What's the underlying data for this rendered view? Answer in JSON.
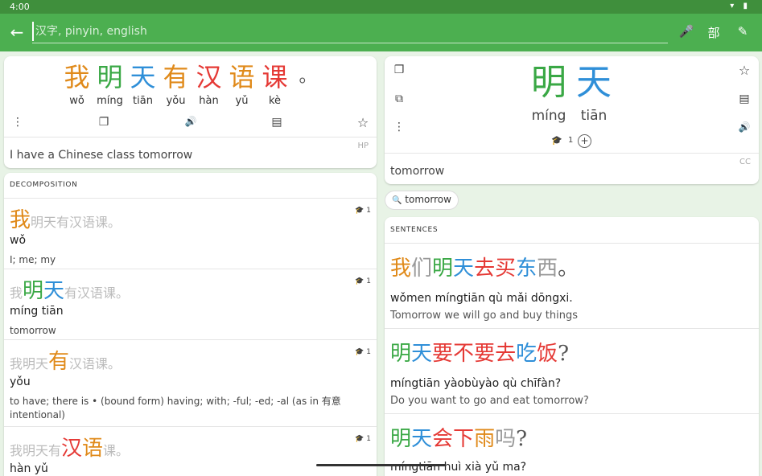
{
  "status": {
    "time": "4:00",
    "icons": "▾ ▮"
  },
  "search": {
    "placeholder": "汉字, pinyin, english",
    "back": "←",
    "mic": "🎤",
    "radical": "部",
    "brush": "✎"
  },
  "main_card": {
    "chars": [
      {
        "hz": "我",
        "py": "wǒ"
      },
      {
        "hz": "明",
        "py": "míng"
      },
      {
        "hz": "天",
        "py": "tiān"
      },
      {
        "hz": "有",
        "py": "yǒu"
      },
      {
        "hz": "汉",
        "py": "hàn"
      },
      {
        "hz": "语",
        "py": "yǔ"
      },
      {
        "hz": "课",
        "py": "kè"
      },
      {
        "hz": "。",
        "py": ""
      }
    ],
    "translation": "I have a Chinese class tomorrow",
    "source": "HP",
    "icons": {
      "more": "⋮",
      "copy": "❐",
      "audio": "🔊",
      "comment": "▤",
      "star": "☆"
    }
  },
  "word_card": {
    "chars": [
      {
        "hz": "明",
        "py": "míng"
      },
      {
        "hz": "天",
        "py": "tiān"
      }
    ],
    "level": "1",
    "add": "+",
    "translation": "tomorrow",
    "source": "CC",
    "chip": "tomorrow",
    "icons": {
      "copy": "❐",
      "open": "⧉",
      "more": "⋮",
      "star": "☆",
      "comment": "▤",
      "audio": "🔊",
      "cap": "🎓",
      "search": "🔍"
    }
  },
  "decomposition": {
    "title": "DECOMPOSITION",
    "items": [
      {
        "pre": "",
        "hl": [
          {
            "t": "我",
            "c": "c0"
          }
        ],
        "post": "明天有汉语课。",
        "py": "wǒ",
        "def": "I; me; my",
        "level": "1"
      },
      {
        "pre": "我",
        "hl": [
          {
            "t": "明",
            "c": "c1"
          },
          {
            "t": "天",
            "c": "c2"
          }
        ],
        "post": "有汉语课。",
        "py": "míng tiān",
        "def": "tomorrow",
        "level": "1"
      },
      {
        "pre": "我明天",
        "hl": [
          {
            "t": "有",
            "c": "c3"
          }
        ],
        "post": "汉语课。",
        "py": "yǒu",
        "def": "to have; there is • (bound form) having; with; -ful; -ed; -al (as in 有意 intentional)",
        "level": "1"
      },
      {
        "pre": "我明天有",
        "hl": [
          {
            "t": "汉",
            "c": "c4"
          },
          {
            "t": "语",
            "c": "c5"
          }
        ],
        "post": "课。",
        "py": "hàn yǔ",
        "def": "",
        "level": "1"
      }
    ]
  },
  "sentences": {
    "title": "SENTENCES",
    "items": [
      {
        "hz": [
          {
            "t": "我",
            "c": "c0"
          },
          {
            "t": "们",
            "c": "grey"
          },
          {
            "t": "明",
            "c": "c1"
          },
          {
            "t": "天",
            "c": "c2"
          },
          {
            "t": "去",
            "c": "c4"
          },
          {
            "t": "买",
            "c": "c4"
          },
          {
            "t": "东",
            "c": "c2"
          },
          {
            "t": "西",
            "c": "grey"
          },
          {
            "t": "。",
            "c": "cp"
          }
        ],
        "py": "wǒmen míngtiān qù mǎi dōngxi.",
        "en": "Tomorrow we will go and buy things"
      },
      {
        "hz": [
          {
            "t": "明",
            "c": "c1"
          },
          {
            "t": "天",
            "c": "c2"
          },
          {
            "t": "要",
            "c": "c4"
          },
          {
            "t": "不",
            "c": "c4"
          },
          {
            "t": "要",
            "c": "c4"
          },
          {
            "t": "去",
            "c": "c4"
          },
          {
            "t": "吃",
            "c": "c2"
          },
          {
            "t": "饭",
            "c": "c4"
          },
          {
            "t": "?",
            "c": "cp"
          }
        ],
        "py": "míngtiān yàobùyào qù chīfàn?",
        "en": "Do you want to go and eat tomorrow?"
      },
      {
        "hz": [
          {
            "t": "明",
            "c": "c1"
          },
          {
            "t": "天",
            "c": "c2"
          },
          {
            "t": "会",
            "c": "c4"
          },
          {
            "t": "下",
            "c": "c4"
          },
          {
            "t": "雨",
            "c": "c0"
          },
          {
            "t": "吗",
            "c": "grey"
          },
          {
            "t": "?",
            "c": "cp"
          }
        ],
        "py": "míngtiān huì xià yǔ ma?",
        "en": ""
      }
    ]
  }
}
